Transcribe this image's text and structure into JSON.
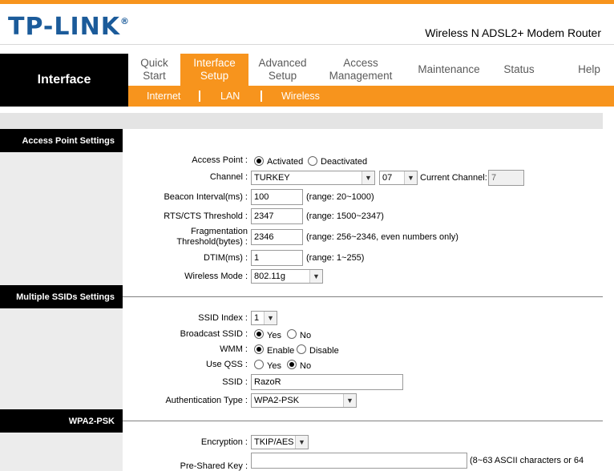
{
  "brand": {
    "logo": "TP-LINK",
    "reg": "®",
    "model": "Wireless N ADSL2+ Modem Router"
  },
  "nav": {
    "section": "Interface",
    "tabs": [
      {
        "line1": "Quick",
        "line2": "Start"
      },
      {
        "line1": "Interface",
        "line2": "Setup"
      },
      {
        "line1": "Advanced",
        "line2": "Setup"
      },
      {
        "line1": "Access",
        "line2": "Management"
      },
      {
        "line1": "Maintenance",
        "line2": ""
      },
      {
        "line1": "Status",
        "line2": ""
      },
      {
        "line1": "Help",
        "line2": ""
      }
    ],
    "subtabs": [
      "Internet",
      "LAN",
      "Wireless"
    ]
  },
  "sections": {
    "ap": "Access Point Settings",
    "ssid": "Multiple SSIDs Settings",
    "wpa": "WPA2-PSK"
  },
  "ap": {
    "access_point_label": "Access Point :",
    "activated": "Activated",
    "deactivated": "Deactivated",
    "channel_label": "Channel :",
    "channel_country": "TURKEY",
    "channel_num": "07",
    "current_channel_label": "Current Channel:",
    "current_channel": "7",
    "beacon_label": "Beacon Interval(ms) :",
    "beacon_value": "100",
    "beacon_range": "(range: 20~1000)",
    "rts_label": "RTS/CTS Threshold :",
    "rts_value": "2347",
    "rts_range": "(range: 1500~2347)",
    "frag_label1": "Fragmentation",
    "frag_label2": "Threshold(bytes) :",
    "frag_value": "2346",
    "frag_range": "(range: 256~2346, even numbers only)",
    "dtim_label": "DTIM(ms) :",
    "dtim_value": "1",
    "dtim_range": "(range: 1~255)",
    "mode_label": "Wireless Mode :",
    "mode_value": "802.11g"
  },
  "ssid": {
    "index_label": "SSID Index :",
    "index_value": "1",
    "broadcast_label": "Broadcast SSID :",
    "yes": "Yes",
    "no": "No",
    "wmm_label": "WMM :",
    "enable": "Enable",
    "disable": "Disable",
    "qss_label": "Use QSS :",
    "ssid_label": "SSID :",
    "ssid_value": "RazoR",
    "auth_label": "Authentication Type :",
    "auth_value": "WPA2-PSK"
  },
  "wpa": {
    "enc_label": "Encryption :",
    "enc_value": "TKIP/AES",
    "psk_label": "Pre-Shared Key :",
    "psk_value": "",
    "psk_hint": "(8~63 ASCII characters or 64"
  },
  "colors": {
    "accent": "#f7941d",
    "brand": "#1b5b9a"
  }
}
